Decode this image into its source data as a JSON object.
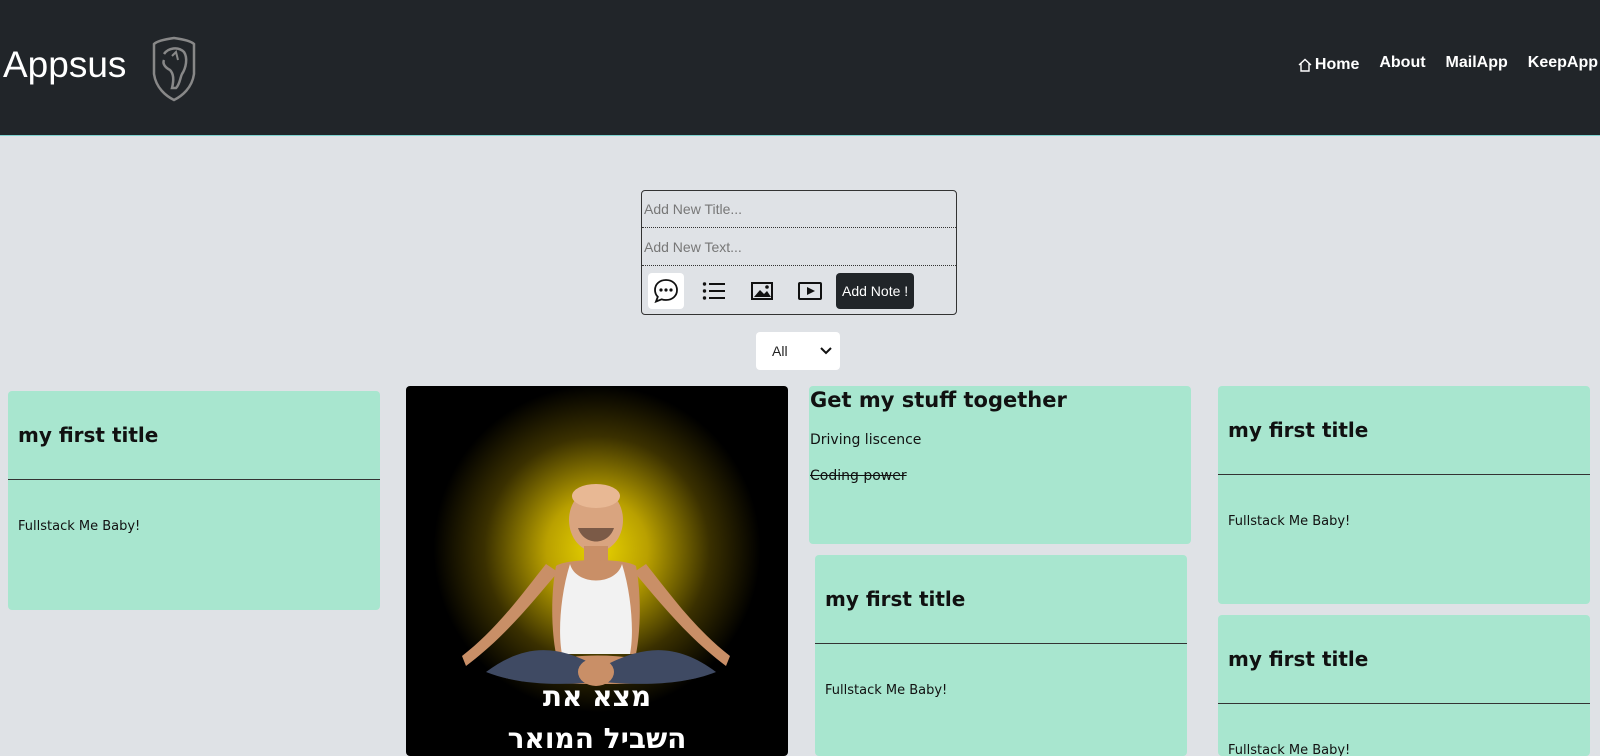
{
  "header": {
    "app_name": "Appsus",
    "nav": [
      {
        "label": "Home",
        "icon": "home-icon"
      },
      {
        "label": "About"
      },
      {
        "label": "MailApp"
      },
      {
        "label": "KeepApp"
      }
    ]
  },
  "composer": {
    "title_placeholder": "Add New Title...",
    "text_placeholder": "Add New Text...",
    "tools": [
      "speech-bubble-icon",
      "list-icon",
      "image-icon",
      "video-icon"
    ],
    "add_label": "Add Note !"
  },
  "filter": {
    "selected": "All"
  },
  "notes": {
    "n1": {
      "title": "my first title",
      "body": "Fullstack Me Baby!"
    },
    "img": {
      "caption_line1": "מצא את",
      "caption_line2": "השביל המואר"
    },
    "todo": {
      "title": "Get my stuff together",
      "items": [
        {
          "text": "Driving liscence",
          "done": false
        },
        {
          "text": "Coding power",
          "done": true
        }
      ]
    },
    "n2": {
      "title": "my first title",
      "body": "Fullstack Me Baby!"
    },
    "n3": {
      "title": "my first title",
      "body": "Fullstack Me Baby!"
    },
    "n4": {
      "title": "my first title",
      "body": "Fullstack Me Baby!"
    }
  },
  "colors": {
    "header_bg": "#212529",
    "page_bg": "#dfe2e6",
    "note_bg": "#a8e6cf"
  }
}
